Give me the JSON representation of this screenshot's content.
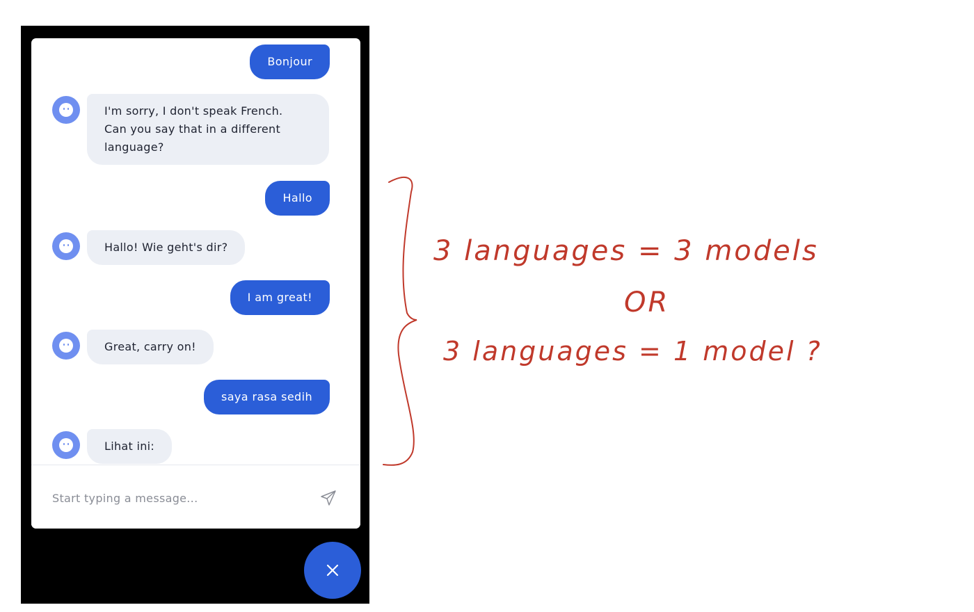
{
  "chat": {
    "messages": [
      {
        "sender": "user",
        "text": "Bonjour"
      },
      {
        "sender": "bot",
        "text": "I'm sorry, I don't speak French.\nCan you say that in a different\nlanguage?"
      },
      {
        "sender": "user",
        "text": "Hallo"
      },
      {
        "sender": "bot",
        "text": "Hallo! Wie geht's dir?"
      },
      {
        "sender": "user",
        "text": "I am great!"
      },
      {
        "sender": "bot",
        "text": "Great, carry on!"
      },
      {
        "sender": "user",
        "text": "saya rasa sedih"
      },
      {
        "sender": "bot",
        "text": "Lihat ini:"
      }
    ],
    "input": {
      "placeholder": "Start typing a message...",
      "value": ""
    },
    "send_icon": "send-icon",
    "close_icon": "close-icon",
    "avatar_icon": "bot-avatar-icon"
  },
  "annotation": {
    "line1": "3 languages = 3 models",
    "line2": "OR",
    "line3": "3 languages = 1 model ?"
  },
  "colors": {
    "accent": "#2b5ed8",
    "bot_bubble": "#eceff5",
    "avatar": "#6f8ff0",
    "frame": "#000000",
    "annotation_ink": "#c0392b"
  }
}
